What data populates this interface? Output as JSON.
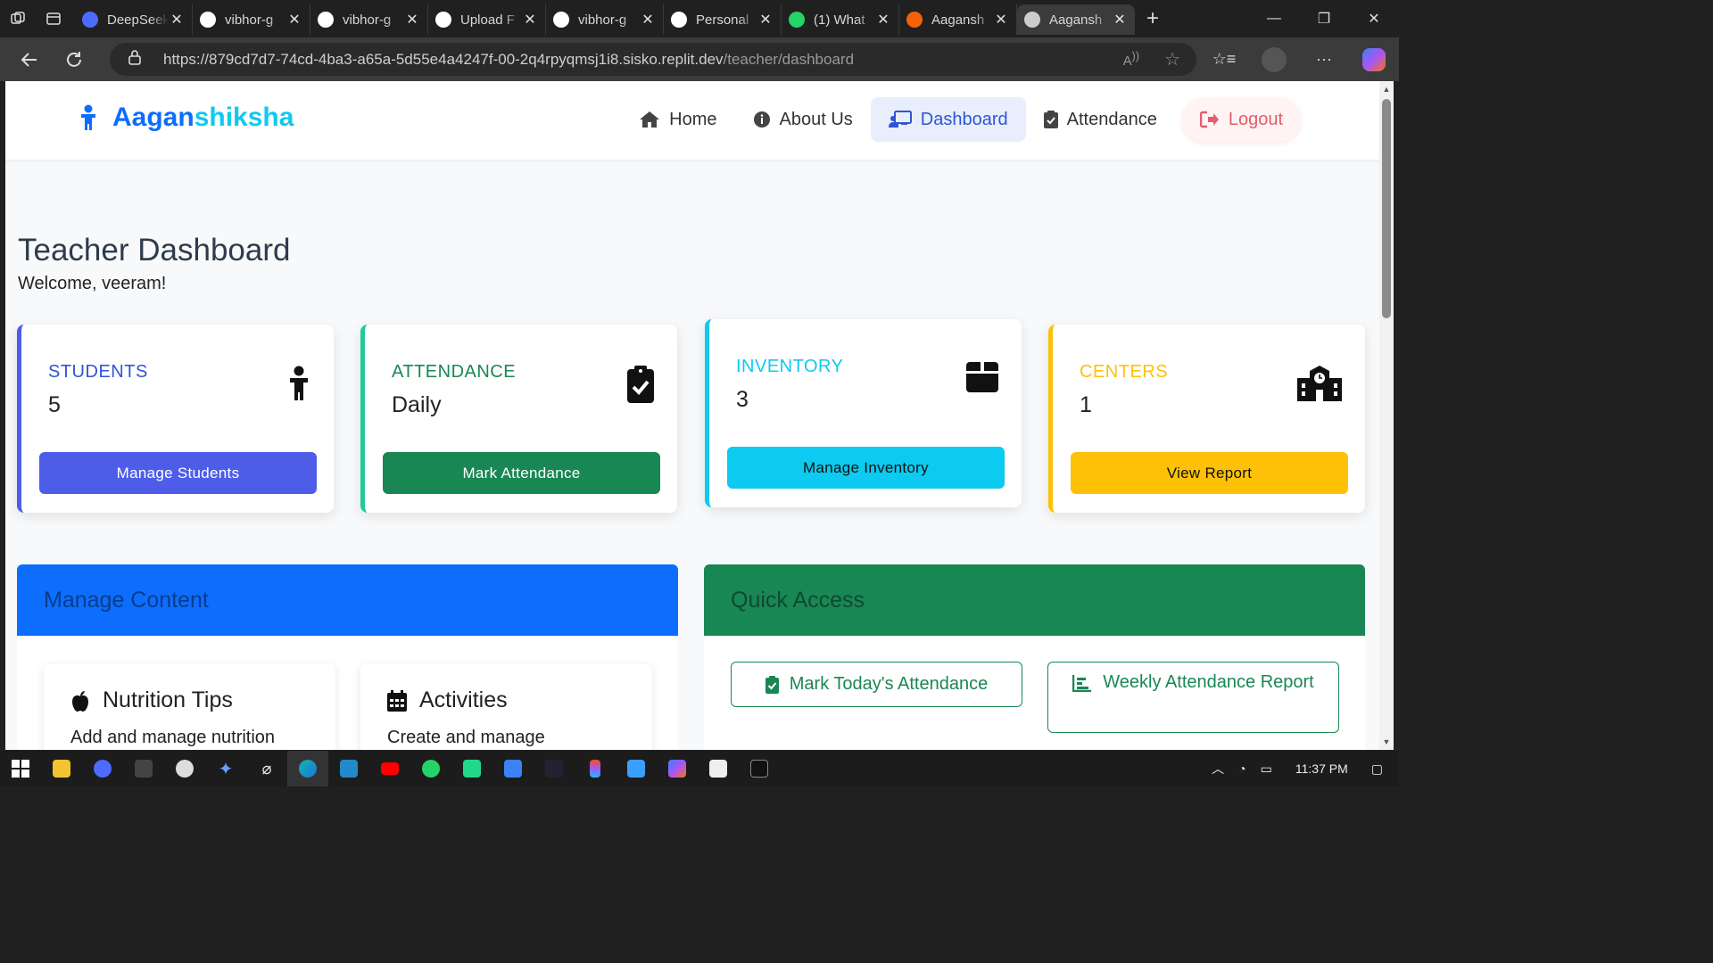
{
  "browser": {
    "tabs": [
      {
        "title": "DeepSeek",
        "icon": "deepseek-icon",
        "color": "#4d6bfe"
      },
      {
        "title": "vibhor-g",
        "icon": "github-icon",
        "color": "#ffffff"
      },
      {
        "title": "vibhor-g",
        "icon": "github-icon",
        "color": "#ffffff"
      },
      {
        "title": "Upload F",
        "icon": "openai-icon",
        "color": "#ffffff"
      },
      {
        "title": "vibhor-g",
        "icon": "github-icon",
        "color": "#ffffff"
      },
      {
        "title": "Personal",
        "icon": "github-icon",
        "color": "#ffffff"
      },
      {
        "title": "(1) What",
        "icon": "whatsapp-icon",
        "color": "#25d366"
      },
      {
        "title": "Aagansh",
        "icon": "replit-icon",
        "color": "#f26207"
      },
      {
        "title": "Aagansh",
        "icon": "globe-icon",
        "color": "#cccccc"
      }
    ],
    "url_host": "https://879cd7d7-74cd-4ba3-a65a-5d55e4a4247f-00-2q4rpyqmsj1i8.sisko.replit.dev",
    "url_path": "/teacher/dashboard"
  },
  "navbar": {
    "brand_part1": "Aagan",
    "brand_part2": "shiksha",
    "links": [
      "Home",
      "About Us",
      "Dashboard",
      "Attendance",
      "Logout"
    ]
  },
  "header": {
    "title": "Teacher Dashboard",
    "welcome": "Welcome, veeram!"
  },
  "cards": [
    {
      "label": "STUDENTS",
      "value": "5",
      "button": "Manage Students",
      "color": "#4e5de8",
      "icon": "child-icon"
    },
    {
      "label": "ATTENDANCE",
      "value": "Daily",
      "button": "Mark Attendance",
      "color": "#198754",
      "icon": "clipboard-check-icon"
    },
    {
      "label": "INVENTORY",
      "value": "3",
      "button": "Manage Inventory",
      "color": "#0dcaf0",
      "icon": "box-icon"
    },
    {
      "label": "CENTERS",
      "value": "1",
      "button": "View Report",
      "color": "#ffc107",
      "icon": "school-icon"
    }
  ],
  "manage_content": {
    "title": "Manage Content",
    "items": [
      {
        "title": "Nutrition Tips",
        "desc": "Add and manage nutrition",
        "icon": "apple-icon"
      },
      {
        "title": "Activities",
        "desc": "Create and manage",
        "icon": "calendar-icon"
      }
    ]
  },
  "quick_access": {
    "title": "Quick Access",
    "buttons": [
      "Mark Today's Attendance",
      "Weekly Attendance Report"
    ]
  },
  "taskbar": {
    "time": "11:37 PM"
  }
}
